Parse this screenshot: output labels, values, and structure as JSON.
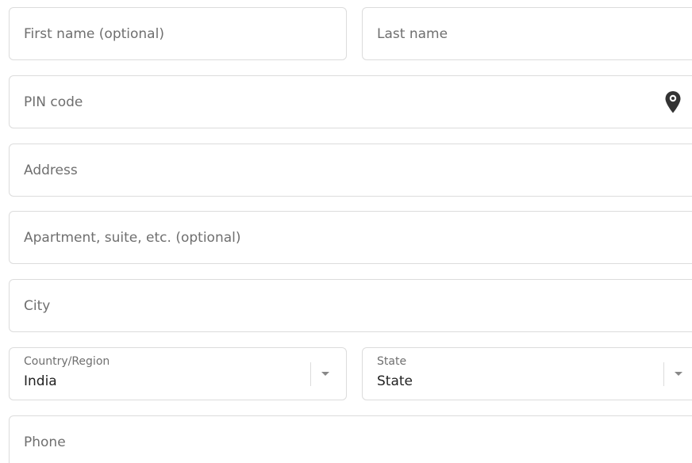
{
  "form": {
    "first_name": {
      "placeholder": "First name (optional)",
      "value": ""
    },
    "last_name": {
      "placeholder": "Last name",
      "value": ""
    },
    "pin_code": {
      "placeholder": "PIN code",
      "value": "",
      "icon": "location-pin-icon"
    },
    "address": {
      "placeholder": "Address",
      "value": ""
    },
    "apartment": {
      "placeholder": "Apartment, suite, etc. (optional)",
      "value": ""
    },
    "city": {
      "placeholder": "City",
      "value": ""
    },
    "country": {
      "label": "Country/Region",
      "selected": "India"
    },
    "state": {
      "label": "State",
      "selected": "State"
    },
    "phone": {
      "placeholder": "Phone",
      "value": ""
    }
  },
  "colors": {
    "border": "#dcdcdc",
    "placeholder": "#6f6f6f",
    "text": "#222222",
    "icon": "#333333"
  }
}
